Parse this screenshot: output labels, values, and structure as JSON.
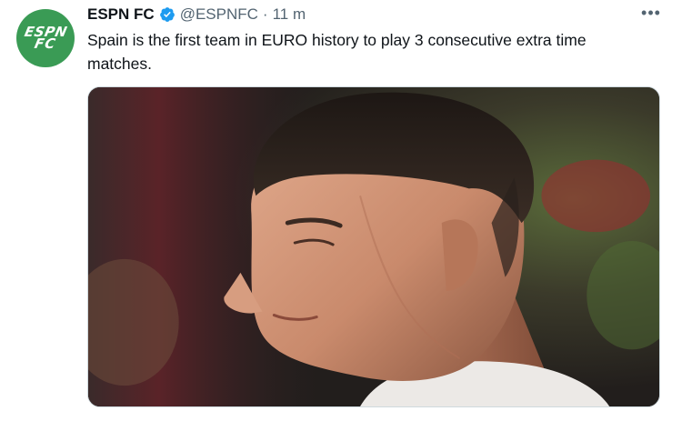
{
  "tweet": {
    "author_name": "ESPN FC",
    "avatar_text": [
      "ESPN",
      "FC"
    ],
    "verified": true,
    "handle": "@ESPNFC",
    "separator": "·",
    "time": "11 m",
    "more_label": "•••",
    "text": "Spain is the first team in EURO history to play 3 consecutive extra time matches.",
    "media": {
      "type": "photo",
      "subject": "player-closeup"
    }
  },
  "colors": {
    "avatar_bg": "#3a9b55",
    "verified_blue": "#1d9bf0",
    "text": "#0f1419",
    "secondary": "#536471"
  }
}
